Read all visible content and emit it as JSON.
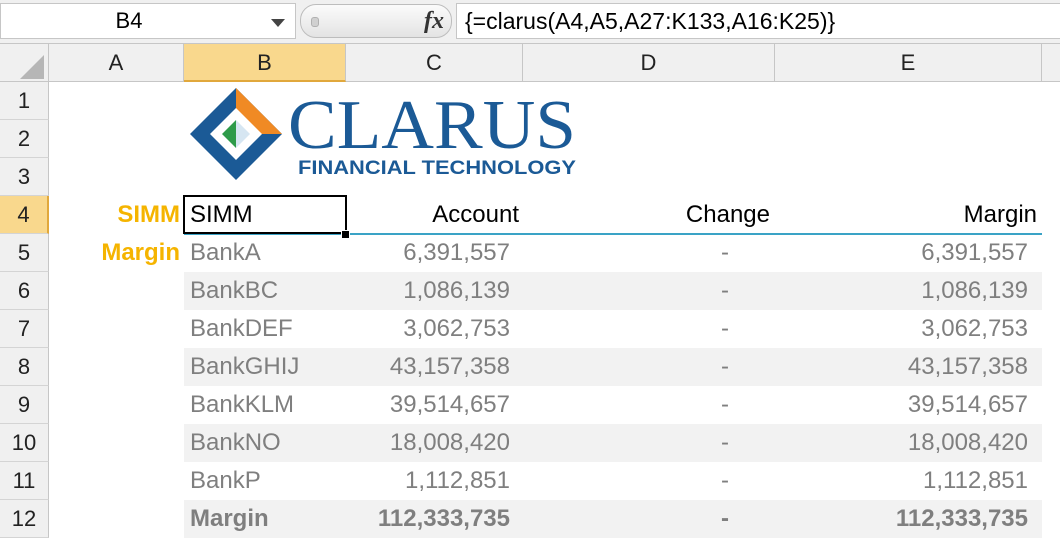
{
  "formula_bar": {
    "name_box": "B4",
    "fx_label": "fx",
    "formula": "{=clarus(A4,A5,A27:K133,A16:K25)}"
  },
  "columns": [
    "A",
    "B",
    "C",
    "D",
    "E"
  ],
  "rows": [
    "1",
    "2",
    "3",
    "4",
    "5",
    "6",
    "7",
    "8",
    "9",
    "10",
    "11",
    "12"
  ],
  "logo": {
    "name": "CLARUS",
    "tagline": "FINANCIAL TECHNOLOGY",
    "colors": {
      "blue": "#1b5a96",
      "orange": "#f08a24",
      "green": "#2e9b4a"
    }
  },
  "sheet": {
    "labels": {
      "a4": "SIMM",
      "a5": "Margin"
    },
    "header": {
      "b": "SIMM",
      "c": "Account",
      "d": "Change",
      "e": "Margin"
    },
    "data_rows": [
      {
        "b": "BankA",
        "c": "6,391,557",
        "d": "-",
        "e": "6,391,557"
      },
      {
        "b": "BankBC",
        "c": "1,086,139",
        "d": "-",
        "e": "1,086,139"
      },
      {
        "b": "BankDEF",
        "c": "3,062,753",
        "d": "-",
        "e": "3,062,753"
      },
      {
        "b": "BankGHIJ",
        "c": "43,157,358",
        "d": "-",
        "e": "43,157,358"
      },
      {
        "b": "BankKLM",
        "c": "39,514,657",
        "d": "-",
        "e": "39,514,657"
      },
      {
        "b": "BankNO",
        "c": "18,008,420",
        "d": "-",
        "e": "18,008,420"
      },
      {
        "b": "BankP",
        "c": "1,112,851",
        "d": "-",
        "e": "1,112,851"
      }
    ],
    "total_row": {
      "b": "Margin",
      "c": "112,333,735",
      "d": "-",
      "e": "112,333,735"
    }
  },
  "colors": {
    "accent_label": "#f5b400",
    "header_rule": "#3aa3c6",
    "selection_header": "#f9d88d",
    "value_text": "#7f7f7f"
  }
}
